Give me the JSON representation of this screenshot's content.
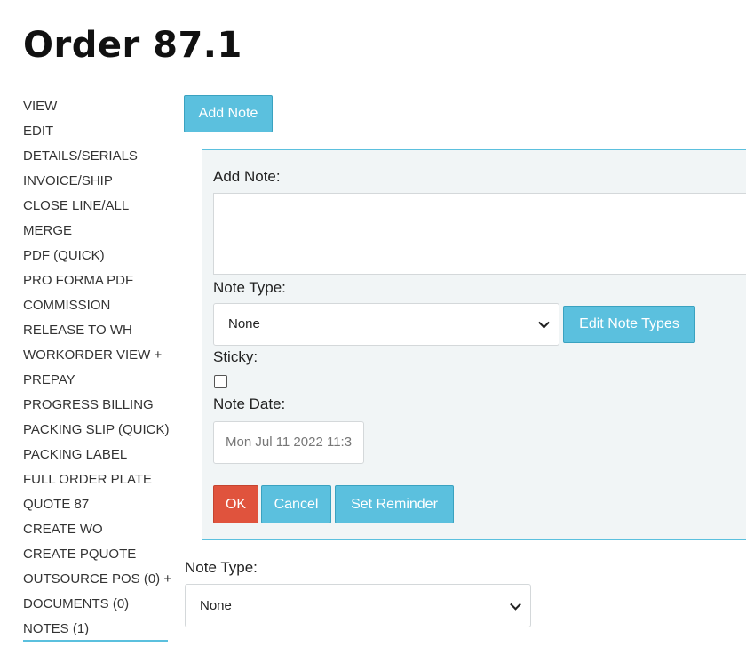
{
  "page": {
    "title": "Order 87.1"
  },
  "sidebar": {
    "items": [
      {
        "label": "VIEW"
      },
      {
        "label": "EDIT"
      },
      {
        "label": "DETAILS/SERIALS"
      },
      {
        "label": "INVOICE/SHIP"
      },
      {
        "label": "CLOSE LINE/ALL"
      },
      {
        "label": "MERGE"
      },
      {
        "label": "PDF (QUICK)"
      },
      {
        "label": "PRO FORMA PDF"
      },
      {
        "label": "COMMISSION"
      },
      {
        "label": "RELEASE TO WH"
      },
      {
        "label": "WORKORDER VIEW +"
      },
      {
        "label": "PREPAY"
      },
      {
        "label": "PROGRESS BILLING"
      },
      {
        "label": "PACKING SLIP (QUICK)"
      },
      {
        "label": "PACKING LABEL"
      },
      {
        "label": "FULL ORDER PLATE"
      },
      {
        "label": "QUOTE 87"
      },
      {
        "label": "CREATE WO"
      },
      {
        "label": "CREATE PQUOTE"
      },
      {
        "label": "OUTSOURCE POS (0) +"
      },
      {
        "label": "DOCUMENTS (0)"
      },
      {
        "label": "NOTES (1)",
        "active": true
      }
    ]
  },
  "toolbar": {
    "add_note_label": "Add Note"
  },
  "note_form": {
    "add_note_label": "Add Note:",
    "note_text_value": "",
    "note_type_label": "Note Type:",
    "note_type_value": "None",
    "edit_note_types_label": "Edit Note Types",
    "sticky_label": "Sticky:",
    "sticky_checked": false,
    "note_date_label": "Note Date:",
    "note_date_value": "Mon Jul 11 2022 11:3",
    "ok_label": "OK",
    "cancel_label": "Cancel",
    "set_reminder_label": "Set Reminder"
  },
  "filter": {
    "note_type_label": "Note Type:",
    "note_type_value": "None"
  },
  "colors": {
    "accent": "#5bc0de",
    "danger": "#e0533d",
    "panel_bg": "#f1f5f6"
  }
}
